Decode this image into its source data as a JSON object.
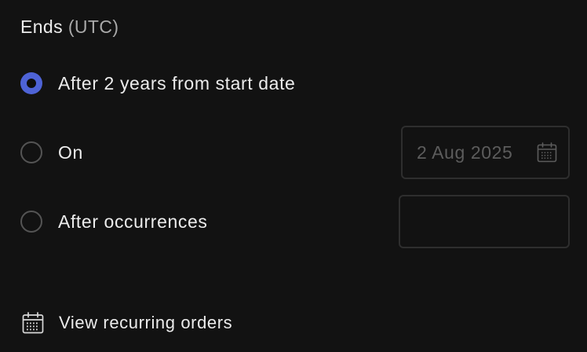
{
  "section": {
    "title": "Ends",
    "title_suffix": "(UTC)"
  },
  "options": [
    {
      "label": "After 2 years from start date",
      "checked": true
    },
    {
      "label": "On",
      "checked": false
    },
    {
      "label": "After occurrences",
      "checked": false
    }
  ],
  "date_input": {
    "value": "2 Aug 2025",
    "icon": "calendar-icon"
  },
  "occurrences_input": {
    "value": "",
    "placeholder": ""
  },
  "view_link": {
    "label": "View recurring orders",
    "icon": "calendar-icon"
  },
  "colors": {
    "background": "#121212",
    "accent": "#4e63d6",
    "text": "#ececec",
    "muted_text": "#a9a9a9",
    "disabled_text": "#5c5c5c",
    "border": "#2e2e2e"
  }
}
